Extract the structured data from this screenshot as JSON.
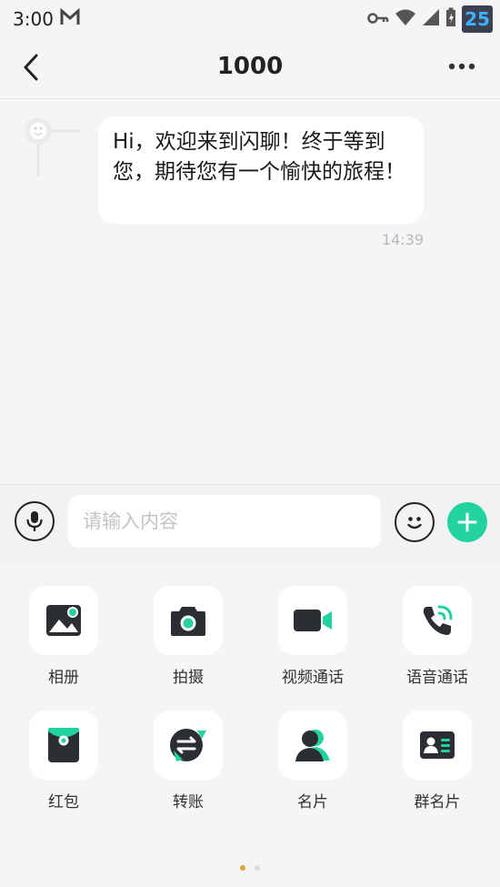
{
  "status_bar": {
    "time": "3:00",
    "battery_level": "25",
    "icons": [
      "gmail-icon",
      "vpn-key-icon",
      "wifi-icon",
      "signal-icon",
      "battery-icon"
    ]
  },
  "header": {
    "title": "1000",
    "back_icon": "chevron-left-icon",
    "more_icon": "more-dots-icon"
  },
  "chat": {
    "messages": [
      {
        "sender": "1000",
        "avatar_icon": "system-avatar-icon",
        "text": "Hi，欢迎来到闪聊！终于等到您，期待您有一个愉快的旅程！",
        "time": "14:39"
      }
    ]
  },
  "input_bar": {
    "placeholder": "请输入内容",
    "value": "",
    "voice_icon": "microphone-icon",
    "emoji_icon": "smiley-icon",
    "plus_icon": "plus-icon"
  },
  "tools": {
    "items": [
      {
        "label": "相册",
        "icon": "album-icon"
      },
      {
        "label": "拍摄",
        "icon": "camera-icon"
      },
      {
        "label": "视频通话",
        "icon": "video-call-icon"
      },
      {
        "label": "语音通话",
        "icon": "phone-call-icon"
      },
      {
        "label": "红包",
        "icon": "red-packet-icon"
      },
      {
        "label": "转账",
        "icon": "transfer-icon"
      },
      {
        "label": "名片",
        "icon": "contact-card-icon"
      },
      {
        "label": "群名片",
        "icon": "group-card-icon"
      }
    ],
    "page_count": 2,
    "active_page": 1
  },
  "colors": {
    "accent": "#22d3a0",
    "icon_dark": "#2b2f33",
    "background": "#f5f5f7",
    "page_dot_active": "#d7a93a"
  }
}
